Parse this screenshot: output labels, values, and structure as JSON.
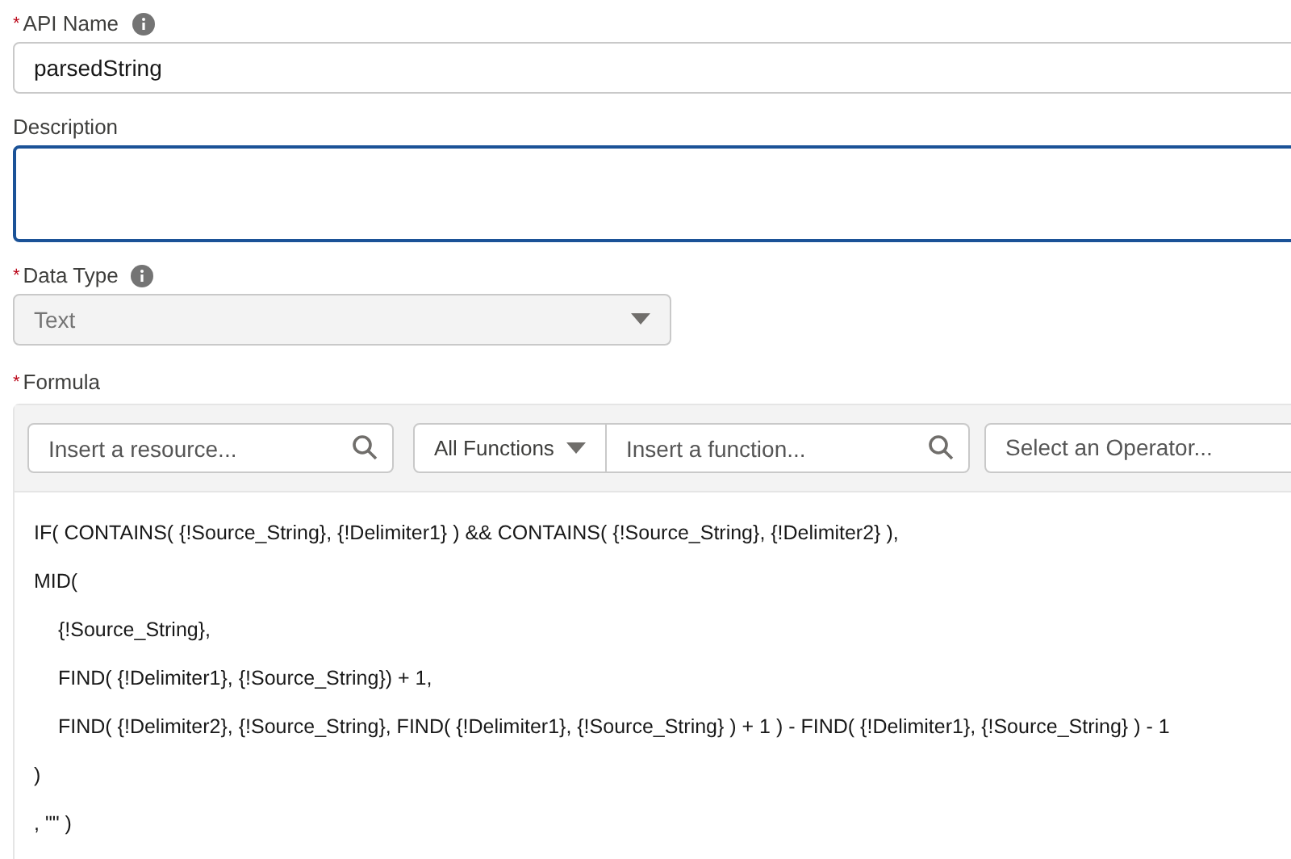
{
  "api_name": {
    "required_mark": "*",
    "label": "API Name",
    "info": true,
    "value": "parsedString"
  },
  "description": {
    "label": "Description",
    "focused": true
  },
  "data_type": {
    "required_mark": "*",
    "label": "Data Type",
    "info": true,
    "value": "Text",
    "disabled": true
  },
  "formula": {
    "required_mark": "*",
    "label": "Formula",
    "resource_search": {
      "placeholder": "Insert a resource..."
    },
    "function_category": {
      "value": "All Functions"
    },
    "function_search": {
      "placeholder": "Insert a function..."
    },
    "operator_select": {
      "placeholder": "Select an Operator..."
    },
    "lines": [
      {
        "text": "IF( CONTAINS( {!Source_String}, {!Delimiter1} ) && CONTAINS( {!Source_String}, {!Delimiter2} ),",
        "indented": false
      },
      {
        "text": "MID(",
        "indented": false
      },
      {
        "text": "{!Source_String},",
        "indented": true
      },
      {
        "text": "FIND( {!Delimiter1}, {!Source_String}) + 1,",
        "indented": true
      },
      {
        "text": "FIND( {!Delimiter2}, {!Source_String}, FIND( {!Delimiter1}, {!Source_String} ) + 1 ) - FIND( {!Delimiter1}, {!Source_String} ) - 1",
        "indented": true
      },
      {
        "text": ")",
        "indented": false
      },
      {
        "text": ", \"\" )",
        "indented": false
      }
    ]
  }
}
